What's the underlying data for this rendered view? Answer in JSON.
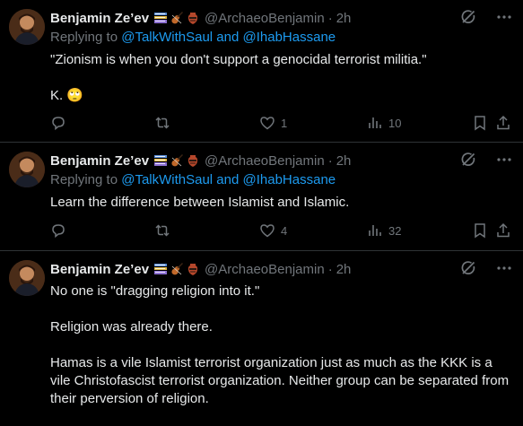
{
  "tweets": [
    {
      "author": "Benjamin Ze’ev",
      "handle": "@ArchaeoBenjamin",
      "separator": "·",
      "time": "2h",
      "replying_prefix": "Replying to",
      "replying_users": "@TalkWithSaul and @IhabHassane",
      "text_lines": [
        "\"Zionism is when you don't support a genocidal terrorist militia.\"",
        "K. 🙄"
      ],
      "likes": "1",
      "views": "10"
    },
    {
      "author": "Benjamin Ze’ev",
      "handle": "@ArchaeoBenjamin",
      "separator": "·",
      "time": "2h",
      "replying_prefix": "Replying to",
      "replying_users": "@TalkWithSaul and @IhabHassane",
      "text_lines": [
        "Learn the difference between Islamist and Islamic."
      ],
      "likes": "4",
      "views": "32"
    },
    {
      "author": "Benjamin Ze’ev",
      "handle": "@ArchaeoBenjamin",
      "separator": "·",
      "time": "2h",
      "text_lines": [
        "No one is \"dragging religion into it.\"",
        "Religion was already there.",
        "Hamas is a vile Islamist terrorist organization just as much as the KKK is a vile Christofascist terrorist organization. Neither group can be separated from their perversion of religion."
      ]
    }
  ],
  "icons": {
    "header": [
      "grok-icon",
      "more-icon"
    ],
    "actions": [
      "reply-icon",
      "retweet-icon",
      "like-icon",
      "views-icon",
      "bookmark-icon",
      "share-icon"
    ],
    "name_badges": [
      "books-emoji",
      "violin-emoji",
      "amphora-emoji"
    ]
  },
  "colors": {
    "background": "#000000",
    "text": "#e7e9ea",
    "muted": "#71767b",
    "link": "#1d9bf0",
    "divider": "#2f3336"
  }
}
